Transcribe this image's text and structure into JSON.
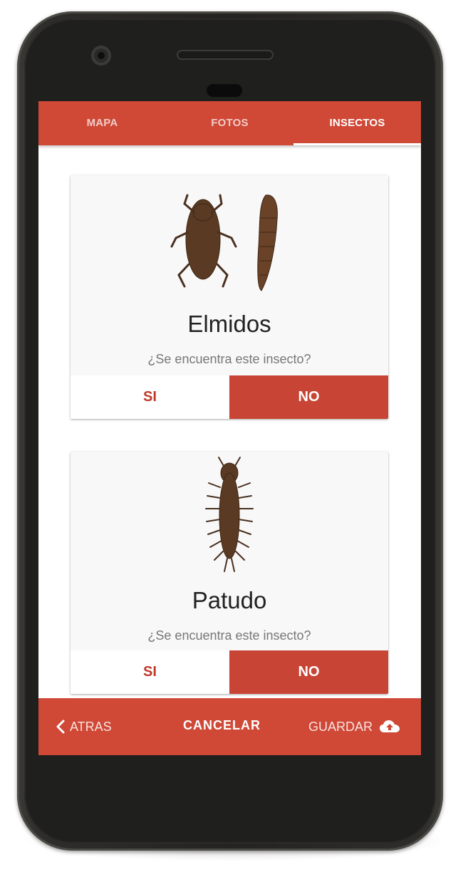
{
  "tabs": [
    {
      "label": "MAPA",
      "active": false
    },
    {
      "label": "FOTOS",
      "active": false
    },
    {
      "label": "INSECTOS",
      "active": true
    }
  ],
  "cards": [
    {
      "name": "Elmidos",
      "question": "¿Se encuentra este insecto?",
      "yes_label": "SI",
      "no_label": "NO"
    },
    {
      "name": "Patudo",
      "question": "¿Se encuentra este insecto?",
      "yes_label": "SI",
      "no_label": "NO"
    }
  ],
  "bottom_bar": {
    "back_label": "ATRAS",
    "cancel_label": "CANCELAR",
    "save_label": "GUARDAR",
    "back_icon": "chevron-left-icon",
    "save_icon": "cloud-upload-icon"
  },
  "colors": {
    "primary": "#d04836",
    "no_button": "#c84434",
    "yes_text": "#c0392b",
    "insect_brown": "#5a3a22"
  }
}
